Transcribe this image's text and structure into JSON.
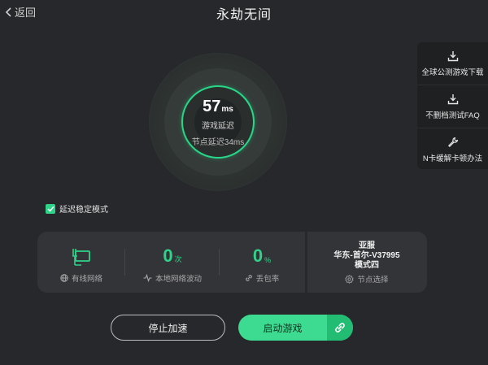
{
  "header": {
    "back_label": "返回",
    "title": "永劫无间"
  },
  "latency": {
    "value": "57",
    "unit": "ms",
    "label": "游戏延迟",
    "node_delay": "节点延迟34ms"
  },
  "side_menu": {
    "items": [
      {
        "label": "全球公测游戏下载",
        "icon": "download-icon"
      },
      {
        "label": "不删档测试FAQ",
        "icon": "download-icon"
      },
      {
        "label": "N卡缓解卡顿办法",
        "icon": "wrench-icon"
      }
    ]
  },
  "stable_mode": {
    "label": "延迟稳定模式",
    "checked": true
  },
  "stats": {
    "network": {
      "label": "有线网络",
      "icon": "wired-network-icon"
    },
    "jitter": {
      "value": "0",
      "unit": "次",
      "label": "本地网络波动"
    },
    "loss": {
      "value": "0",
      "unit": "%",
      "label": "丢包率"
    },
    "server": {
      "region": "亚服",
      "node": "华东-首尔-V37995",
      "mode": "模式四",
      "select_label": "节点选择"
    }
  },
  "actions": {
    "stop_label": "停止加速",
    "start_label": "启动游戏"
  },
  "colors": {
    "accent": "#2fd289",
    "background": "#27282b",
    "panel": "#333438"
  }
}
